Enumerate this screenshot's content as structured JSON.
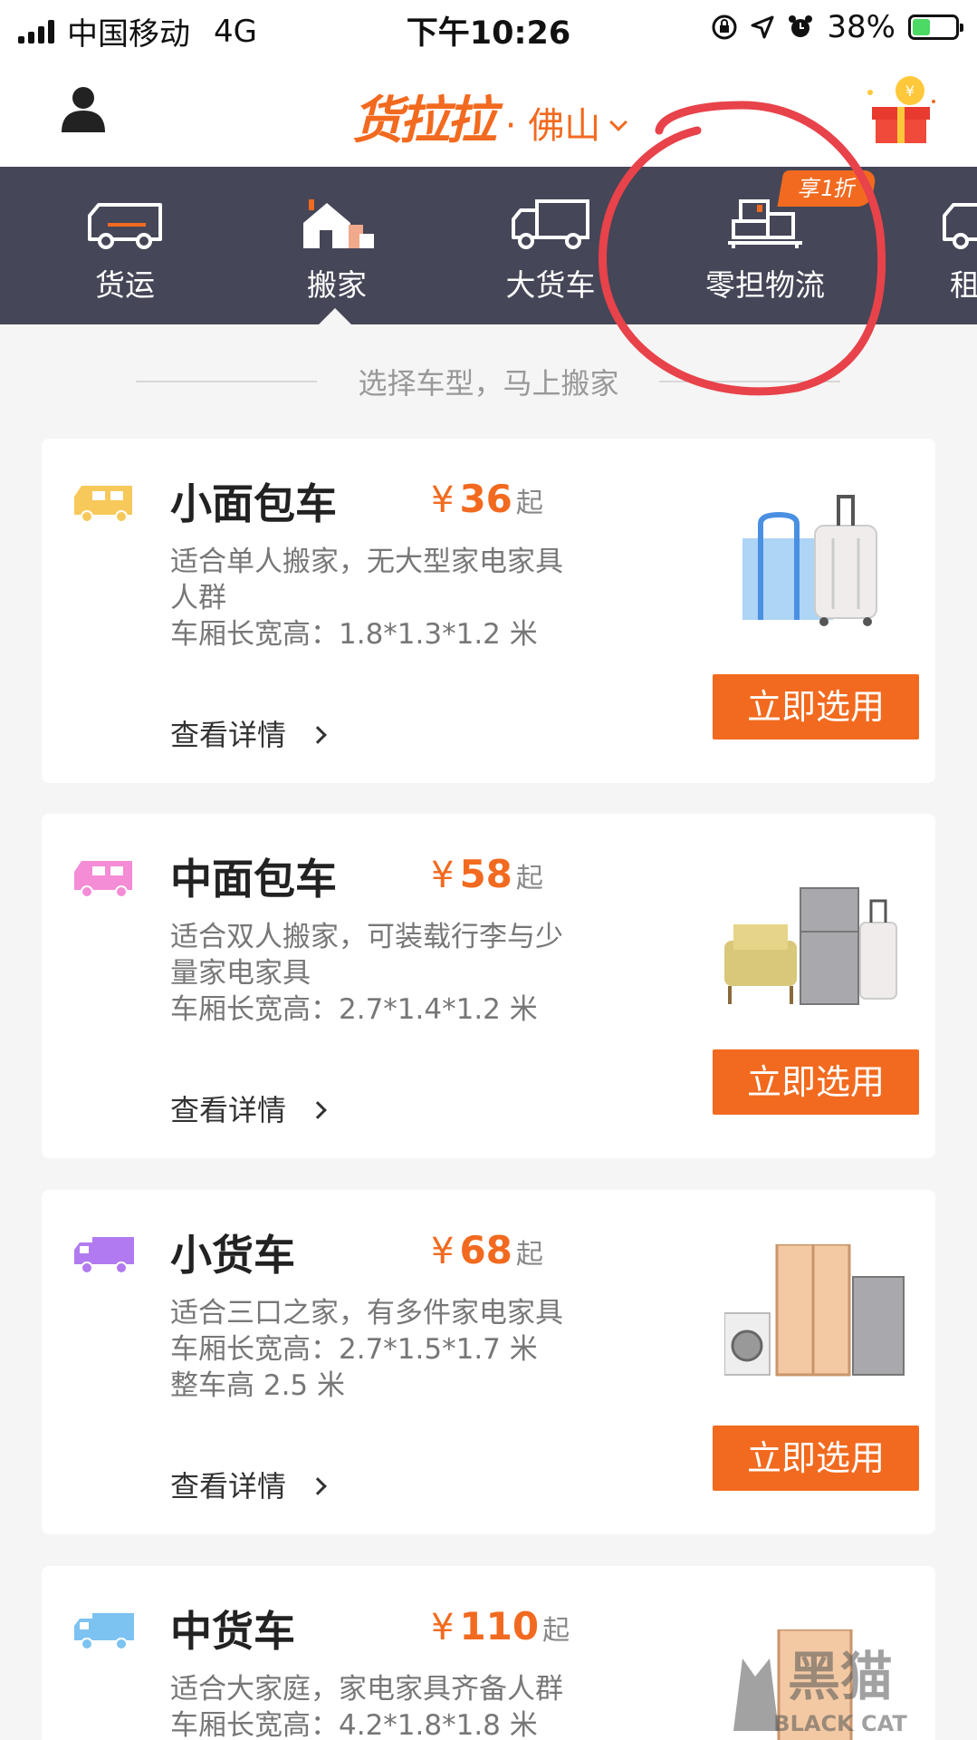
{
  "status_bar": {
    "carrier": "中国移动",
    "network": "4G",
    "time": "下午10:26",
    "battery": "38%"
  },
  "header": {
    "logo_text": "货拉拉",
    "city": "· 佛山"
  },
  "nav": {
    "items": [
      {
        "label": "货运",
        "icon": "van-icon"
      },
      {
        "label": "搬家",
        "icon": "house-icon",
        "active": true
      },
      {
        "label": "大货车",
        "icon": "truck-icon"
      },
      {
        "label": "零担物流",
        "icon": "pallet-boxes-icon"
      },
      {
        "label": "租买",
        "icon": "van-icon"
      }
    ],
    "promo_badge": "享1折"
  },
  "section_title": "选择车型，马上搬家",
  "vehicles": [
    {
      "name": "小面包车",
      "currency": "¥",
      "price": "36",
      "price_suffix": "起",
      "desc_line1": "适合单人搬家，无大型家电家具",
      "desc_line2": "人群",
      "desc_line3": "车厢长宽高：1.8*1.3*1.2 米",
      "details": "查看详情",
      "button": "立即选用",
      "icon_color": "#f7c95b"
    },
    {
      "name": "中面包车",
      "currency": "¥",
      "price": "58",
      "price_suffix": "起",
      "desc_line1": "适合双人搬家，可装载行李与少",
      "desc_line2": "量家电家具",
      "desc_line3": "车厢长宽高：2.7*1.4*1.2 米",
      "details": "查看详情",
      "button": "立即选用",
      "icon_color": "#f48cd6"
    },
    {
      "name": "小货车",
      "currency": "¥",
      "price": "68",
      "price_suffix": "起",
      "desc_line1": "适合三口之家，有多件家电家具",
      "desc_line2": "车厢长宽高：2.7*1.5*1.7 米",
      "desc_line3": "整车高 2.5 米",
      "details": "查看详情",
      "button": "立即选用",
      "icon_color": "#b27af0"
    },
    {
      "name": "中货车",
      "currency": "¥",
      "price": "110",
      "price_suffix": "起",
      "desc_line1": "适合大家庭，家电家具齐备人群",
      "desc_line2": "车厢长宽高：4.2*1.8*1.8 米",
      "icon_color": "#7cc3f2"
    }
  ],
  "watermark": {
    "text": "黑猫",
    "sub": "BLACK CAT"
  }
}
